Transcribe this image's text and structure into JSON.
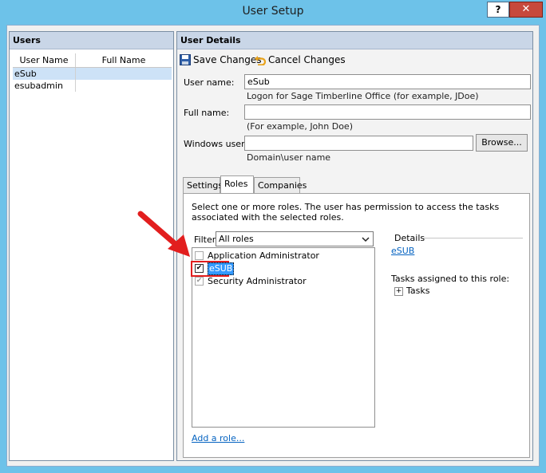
{
  "window": {
    "title": "User Setup",
    "help_label": "?",
    "close_label": "✕"
  },
  "users_panel": {
    "header": "Users",
    "columns": [
      "User Name",
      "Full Name"
    ],
    "rows": [
      {
        "user_name": "eSub",
        "full_name": ""
      },
      {
        "user_name": "esubadmin",
        "full_name": ""
      }
    ]
  },
  "details_panel": {
    "header": "User Details",
    "toolbar": {
      "save_label": "Save Changes",
      "cancel_label": "Cancel Changes"
    },
    "form": {
      "username_label": "User name:",
      "username_value": "eSub",
      "username_hint": "Logon for Sage Timberline Office (for example, JDoe)",
      "fullname_label": "Full name:",
      "fullname_value": "",
      "fullname_hint": "(For example, John Doe)",
      "winuser_label": "Windows user:",
      "winuser_value": "",
      "winuser_hint": "Domain\\user name",
      "browse_label": "Browse..."
    },
    "tabs": [
      "Settings",
      "Roles",
      "Companies"
    ],
    "active_tab": "Roles",
    "roles_tab": {
      "description": "Select one or more roles. The user has permission to access the tasks associated with the selected roles.",
      "filter_label": "Filter:",
      "filter_value": "All roles",
      "roles": [
        {
          "name": "Application Administrator",
          "checked": false
        },
        {
          "name": "eSUB",
          "checked": true
        },
        {
          "name": "Security Administrator",
          "checked": true
        }
      ],
      "add_role_link": "Add a role...",
      "details_label": "Details",
      "details_role_link": "eSUB",
      "tasks_assigned_label": "Tasks assigned to this role:",
      "tasks_node_label": "Tasks",
      "expand_symbol": "+"
    }
  },
  "colors": {
    "window_frame": "#6dc2e9",
    "panel_header": "#c9d6e7",
    "selection": "#3399ff",
    "highlight_red": "#e21e1e",
    "link_blue": "#0563c1",
    "close_red": "#c7493c"
  },
  "icons": {
    "save": "floppy-disk-icon",
    "cancel": "undo-arrow-icon",
    "dropdown": "chevron-down-icon",
    "annotation": "red-arrow-icon"
  }
}
